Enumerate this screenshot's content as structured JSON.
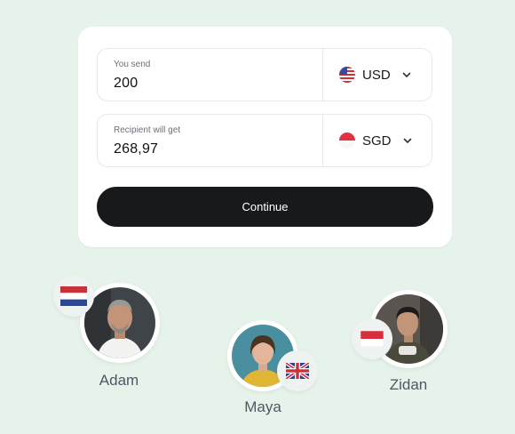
{
  "converter": {
    "send": {
      "label": "You send",
      "amount": "200",
      "currency": "USD",
      "flag_icon": "us-flag-icon"
    },
    "receive": {
      "label": "Recipient will get",
      "amount": "268,97",
      "currency": "SGD",
      "flag_icon": "sg-flag-icon"
    },
    "continue_label": "Continue"
  },
  "people": [
    {
      "name": "Adam",
      "flag_icon": "netherlands-flag-icon"
    },
    {
      "name": "Maya",
      "flag_icon": "uk-flag-icon"
    },
    {
      "name": "Zidan",
      "flag_icon": "indonesia-flag-icon"
    }
  ],
  "colors": {
    "background": "#e6f3ea",
    "card": "#ffffff",
    "button": "#18191b",
    "name_text": "#4d5866"
  }
}
